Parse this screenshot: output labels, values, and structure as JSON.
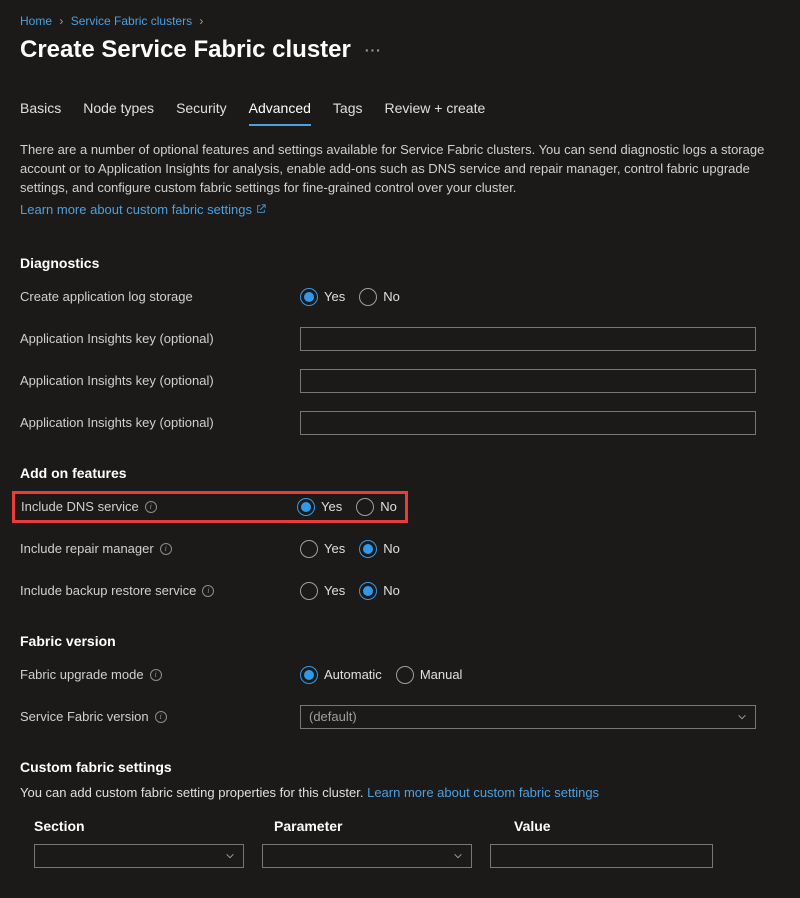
{
  "breadcrumb": {
    "home": "Home",
    "clusters": "Service Fabric clusters"
  },
  "page_title": "Create Service Fabric cluster",
  "tabs": [
    {
      "label": "Basics",
      "active": false
    },
    {
      "label": "Node types",
      "active": false
    },
    {
      "label": "Security",
      "active": false
    },
    {
      "label": "Advanced",
      "active": true
    },
    {
      "label": "Tags",
      "active": false
    },
    {
      "label": "Review + create",
      "active": false
    }
  ],
  "intro_text": "There are a number of optional features and settings available for Service Fabric clusters. You can send diagnostic logs a storage account or to Application Insights for analysis, enable add-ons such as DNS service and repair manager, control fabric upgrade settings, and configure custom fabric settings for fine-grained control over your cluster.",
  "learn_link": "Learn more about custom fabric settings",
  "radio_options": {
    "yes": "Yes",
    "no": "No",
    "automatic": "Automatic",
    "manual": "Manual"
  },
  "diagnostics": {
    "heading": "Diagnostics",
    "create_log_storage_label": "Create application log storage",
    "create_log_storage_value": "yes",
    "ai_key_label": "Application Insights key (optional)",
    "ai_key_1": "",
    "ai_key_2": "",
    "ai_key_3": ""
  },
  "addons": {
    "heading": "Add on features",
    "dns_label": "Include DNS service",
    "dns_value": "yes",
    "repair_label": "Include repair manager",
    "repair_value": "no",
    "backup_label": "Include backup restore service",
    "backup_value": "no"
  },
  "fabric_version": {
    "heading": "Fabric version",
    "upgrade_mode_label": "Fabric upgrade mode",
    "upgrade_mode_value": "automatic",
    "version_label": "Service Fabric version",
    "version_value": "(default)"
  },
  "custom_settings": {
    "heading": "Custom fabric settings",
    "intro": "You can add custom fabric setting properties for this cluster. ",
    "learn": "Learn more about custom fabric settings",
    "col_section": "Section",
    "col_parameter": "Parameter",
    "col_value": "Value",
    "row1": {
      "section": "",
      "parameter": "",
      "value": ""
    }
  }
}
